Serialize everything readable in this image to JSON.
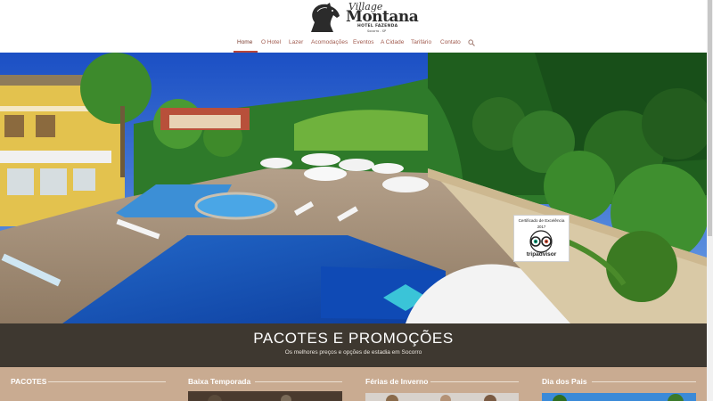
{
  "logo": {
    "line1": "Village",
    "line2": "Montana",
    "line3": "HOTEL FAZENDA",
    "line4": "Socorro - SP"
  },
  "nav": {
    "items": [
      {
        "label": "Home"
      },
      {
        "label": "O Hotel"
      },
      {
        "label": "Lazer"
      },
      {
        "label": "Acomodações"
      },
      {
        "label": "Eventos"
      },
      {
        "label": "A Cidade"
      },
      {
        "label": "Tarifário"
      },
      {
        "label": "Contato"
      }
    ],
    "active": "Home",
    "search_icon": "search-icon"
  },
  "hero": {
    "badge": {
      "title": "Certificado de Excelência",
      "year": "2017",
      "brand": "tripadvisor"
    }
  },
  "promo": {
    "title": "PACOTES E PROMOÇÕES",
    "subtitle": "Os melhores preços e opções de estadia em Socorro"
  },
  "packages": {
    "columns": [
      {
        "title": "PACOTES"
      },
      {
        "title": "Baixa Temporada"
      },
      {
        "title": "Férias de Inverno"
      },
      {
        "title": "Dia dos Pais"
      }
    ]
  },
  "colors": {
    "accent": "#b8463a",
    "nav_text": "#a05a4e",
    "promo_bg": "#3e3830",
    "packages_bg": "#c9ab91"
  }
}
